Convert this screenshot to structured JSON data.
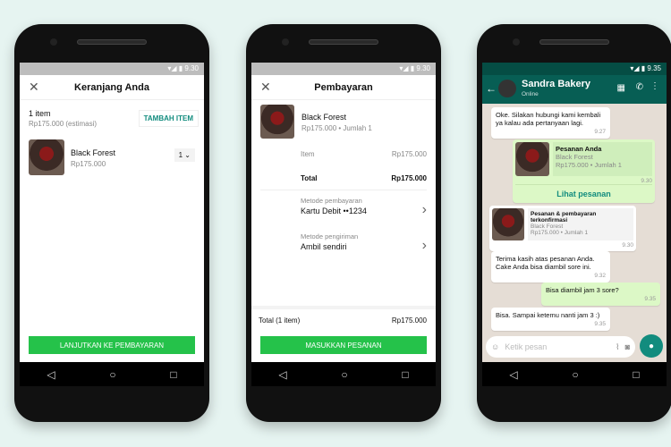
{
  "status": {
    "time1": "9.30",
    "time2": "9.30",
    "time3": "9.35"
  },
  "cart": {
    "title": "Keranjang Anda",
    "count": "1 item",
    "estimate": "Rp175.000 (estimasi)",
    "add_button": "TAMBAH ITEM",
    "product": "Black Forest",
    "price": "Rp175.000",
    "qty": "1",
    "continue": "LANJUTKAN KE PEMBAYARAN"
  },
  "payment": {
    "title": "Pembayaran",
    "product": "Black Forest",
    "sub": "Rp175.000 • Jumlah 1",
    "item_label": "Item",
    "item_value": "Rp175.000",
    "total_label": "Total",
    "total_value": "Rp175.000",
    "pay_label": "Metode pembayaran",
    "pay_value": "Kartu Debit ••1234",
    "ship_label": "Metode pengiriman",
    "ship_value": "Ambil sendiri",
    "footer_label": "Total (1 item)",
    "footer_value": "Rp175.000",
    "submit": "MASUKKAN PESANAN"
  },
  "chat": {
    "name": "Sandra Bakery",
    "presence": "Online",
    "m1": "Oke. Silakan hubungi kami kembali ya kalau ada pertanyaan lagi.",
    "m1t": "9.27",
    "order_title": "Pesanan Anda",
    "order_product": "Black Forest",
    "order_sub": "Rp175.000 • Jumlah 1",
    "order_time": "9.30",
    "order_link": "Lihat pesanan",
    "conf_title": "Pesanan & pembayaran terkonfirmasi",
    "conf_product": "Black Forest",
    "conf_sub": "Rp175.000 • Jumlah 1",
    "conf_time": "9.30",
    "m2": "Terima kasih atas pesanan Anda. Cake Anda bisa diambil sore ini.",
    "m2t": "9.32",
    "m3": "Bisa diambil jam 3 sore?",
    "m3t": "9.35",
    "m4": "Bisa. Sampai ketemu nanti jam 3 :)",
    "m4t": "9.35",
    "placeholder": "Ketik pesan"
  },
  "colors": {
    "green": "#25c24a",
    "teal": "#075e54",
    "accent": "#128c7e"
  }
}
